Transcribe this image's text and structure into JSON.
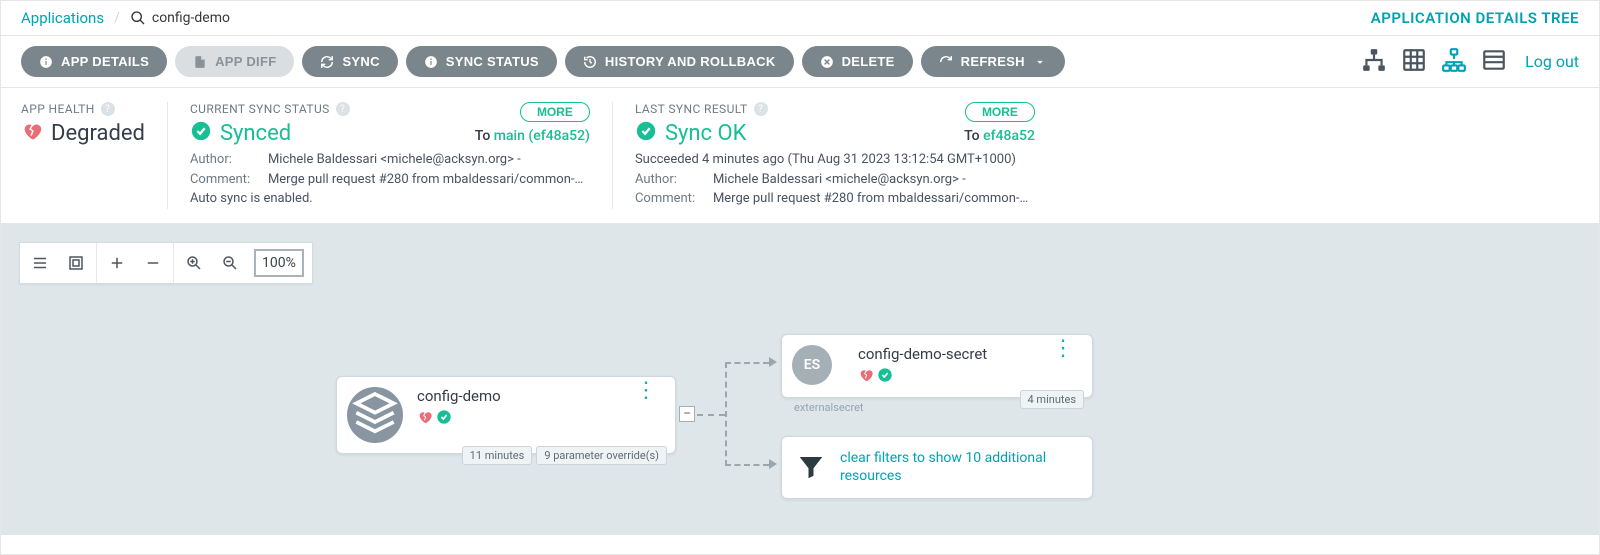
{
  "breadcrumb": {
    "root": "Applications",
    "current": "config-demo"
  },
  "page_title_right": "APPLICATION DETAILS TREE",
  "toolbar": {
    "app_details": "APP DETAILS",
    "app_diff": "APP DIFF",
    "sync": "SYNC",
    "sync_status": "SYNC STATUS",
    "history": "HISTORY AND ROLLBACK",
    "delete": "DELETE",
    "refresh": "REFRESH"
  },
  "logout": "Log out",
  "health": {
    "label": "APP HEALTH",
    "value": "Degraded"
  },
  "sync_status": {
    "label": "CURRENT SYNC STATUS",
    "value": "Synced",
    "more": "MORE",
    "to_prefix": "To ",
    "to_rev": "main (ef48a52)",
    "author_label": "Author:",
    "author_value": "Michele Baldessari <michele@acksyn.org> -",
    "comment_label": "Comment:",
    "comment_value": "Merge pull request #280 from mbaldessari/common-au…",
    "auto_sync": "Auto sync is enabled."
  },
  "last_sync": {
    "label": "LAST SYNC RESULT",
    "value": "Sync OK",
    "more": "MORE",
    "to_prefix": "To ",
    "to_rev": "ef48a52",
    "succeeded": "Succeeded 4 minutes ago (Thu Aug 31 2023 13:12:54 GMT+1000)",
    "author_label": "Author:",
    "author_value": "Michele Baldessari <michele@acksyn.org> -",
    "comment_label": "Comment:",
    "comment_value": "Merge pull request #280 from mbaldessari/common-au…"
  },
  "zoom": "100%",
  "tree": {
    "root": {
      "title": "config-demo",
      "age_badge": "11 minutes",
      "override_badge": "9 parameter override(s)"
    },
    "child": {
      "kind_abbr": "ES",
      "kind_label": "externalsecret",
      "title": "config-demo-secret",
      "age_badge": "4 minutes"
    },
    "filter_hint": "clear filters to show 10 additional resources"
  }
}
